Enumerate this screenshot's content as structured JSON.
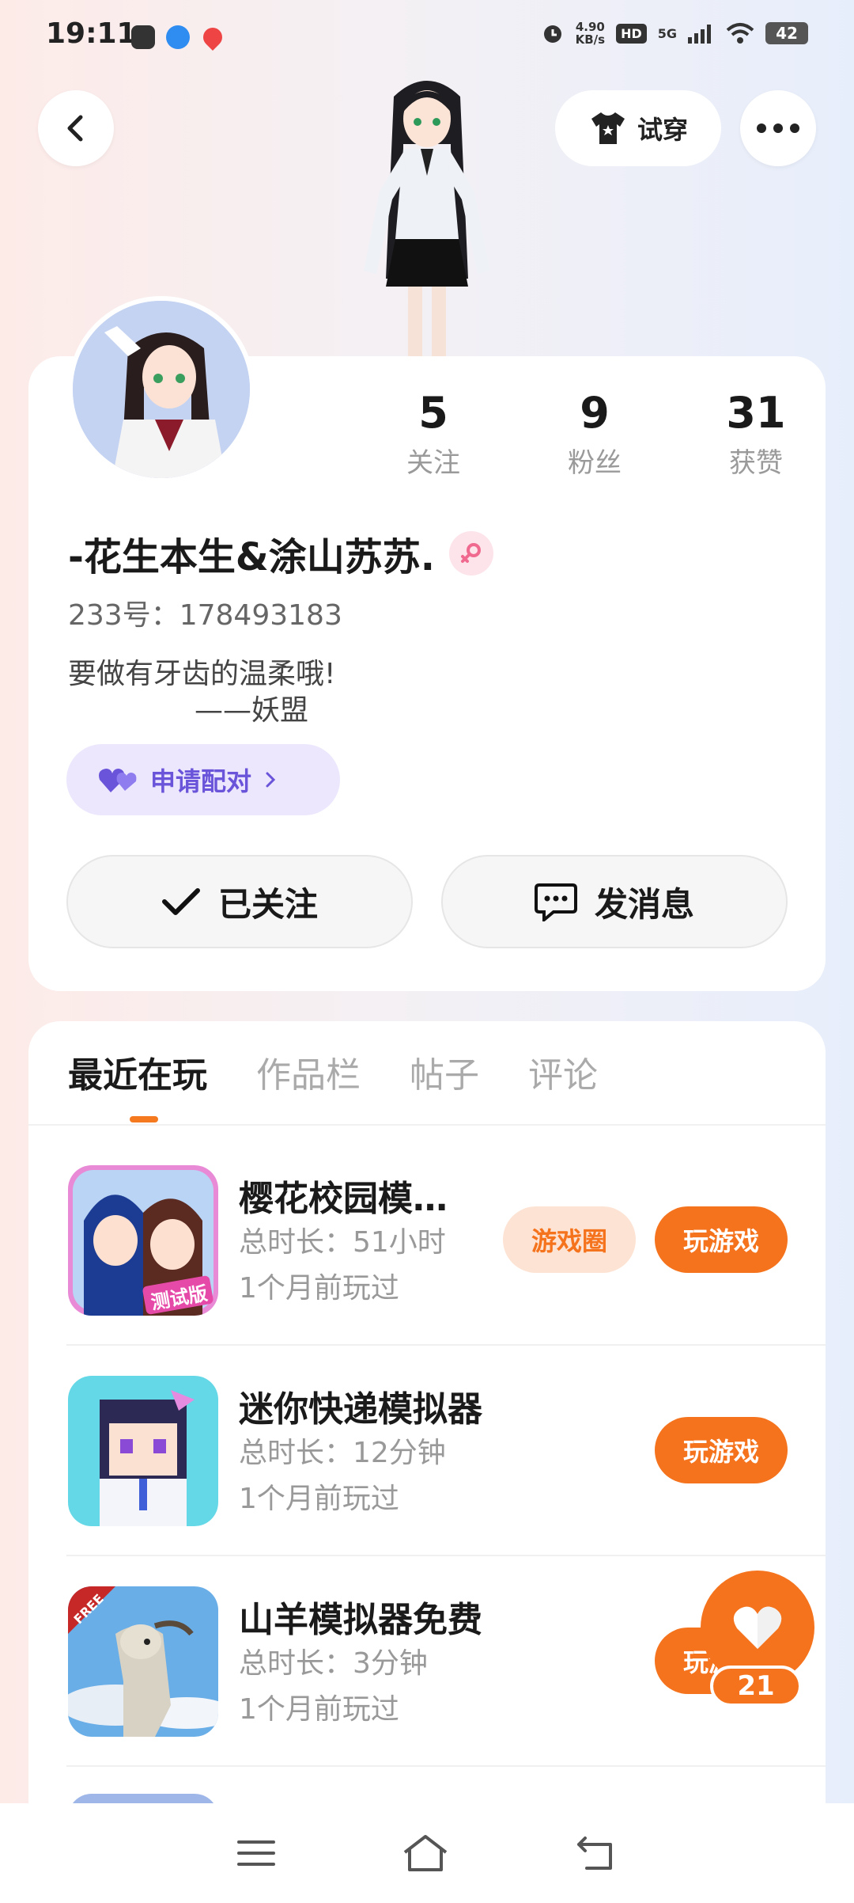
{
  "status_bar": {
    "time": "19:11",
    "net_speed_value": "4.90",
    "net_speed_unit": "KB/s",
    "hd": "HD",
    "network": "5G",
    "battery": "42"
  },
  "header": {
    "try_on_label": "试穿"
  },
  "profile": {
    "stats": [
      {
        "value": "5",
        "label": "关注"
      },
      {
        "value": "9",
        "label": "粉丝"
      },
      {
        "value": "31",
        "label": "获赞"
      }
    ],
    "nickname": "-花生本生&涂山苏苏.",
    "uid": "233号：178493183",
    "bio_line1": "要做有牙齿的温柔哦!",
    "bio_line2": "——妖盟",
    "pair_label": "申请配对",
    "follow_label": "已关注",
    "message_label": "发消息"
  },
  "tabs": [
    "最近在玩",
    "作品栏",
    "帖子",
    "评论"
  ],
  "games": [
    {
      "title": "樱花校园模…",
      "duration": "总时长：51小时",
      "last_played": "1个月前玩过",
      "circle_label": "游戏圈",
      "play_label": "玩游戏"
    },
    {
      "title": "迷你快递模拟器",
      "duration": "总时长：12分钟",
      "last_played": "1个月前玩过",
      "play_label": "玩游戏"
    },
    {
      "title": "山羊模拟器免费",
      "duration": "总时长：3分钟",
      "last_played": "1个月前玩过",
      "play_label": "玩游戏"
    }
  ],
  "game_badges": {
    "test_badge": "测试版",
    "free_badge": "FREE"
  },
  "like_fab": {
    "count": "21"
  },
  "colors": {
    "accent": "#f5731d",
    "pair_purple": "#6a54d9"
  }
}
